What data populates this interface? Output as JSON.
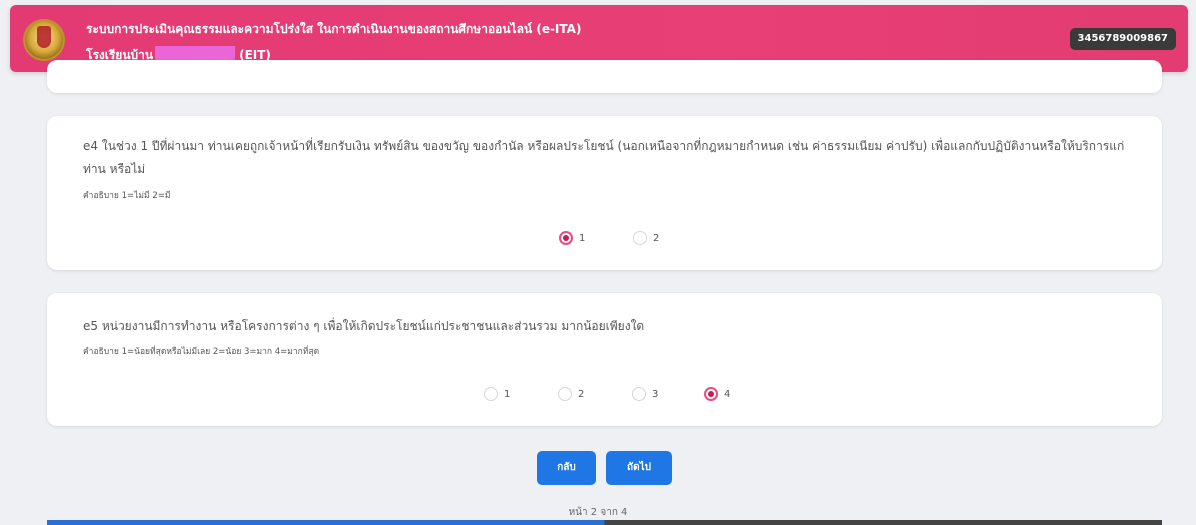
{
  "header": {
    "title": "ระบบการประเมินคุณธรรมและความโปร่งใส ในการดำเนินงานของสถานศึกษาออนไลน์ (e-ITA)",
    "school_prefix": "โรงเรียนบ้าน",
    "school_suffix": "(EIT)",
    "user_code": "3456789009867"
  },
  "questions": [
    {
      "text": "e4 ในช่วง 1 ปีที่ผ่านมา ท่านเคยถูกเจ้าหน้าที่เรียกรับเงิน ทรัพย์สิน ของขวัญ ของกำนัล หรือผลประโยชน์ (นอกเหนือจากที่กฎหมายกำหนด เช่น ค่าธรรมเนียม ค่าปรับ) เพื่อแลกกับปฏิบัติงานหรือให้บริการแก่ท่าน หรือไม่",
      "hint": "คำอธิบาย 1=ไม่มี 2=มี",
      "options": [
        "1",
        "2"
      ],
      "selected": "1"
    },
    {
      "text": "e5 หน่วยงานมีการทำงาน หรือโครงการต่าง ๆ เพื่อให้เกิดประโยชน์แก่ประชาชนและส่วนรวม มากน้อยเพียงใด",
      "hint": "คำอธิบาย 1=น้อยที่สุดหรือไม่มีเลย 2=น้อย 3=มาก 4=มากที่สุด",
      "options": [
        "1",
        "2",
        "3",
        "4"
      ],
      "selected": "4"
    }
  ],
  "nav": {
    "back_label": "กลับ",
    "next_label": "ถัดไป"
  },
  "pager": "หน้า 2 จาก 4"
}
